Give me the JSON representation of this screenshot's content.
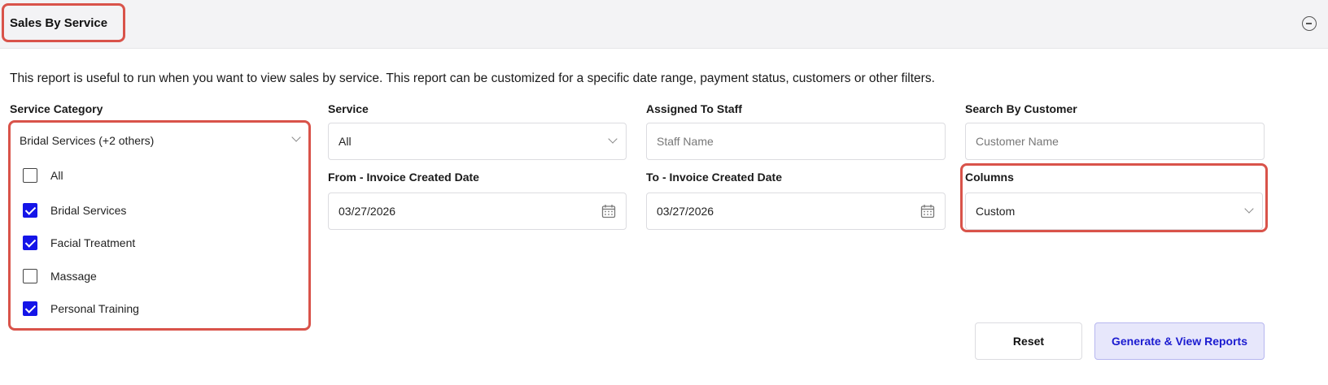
{
  "header": {
    "title": "Sales By Service"
  },
  "description": "This report is useful to run when you want to view sales by service. This report can be customized for a specific date range, payment status, customers or other filters.",
  "filters": {
    "service_category": {
      "label": "Service Category",
      "value": "Bridal Services (+2 others)",
      "options": [
        {
          "label": "All",
          "checked": false
        },
        {
          "label": "Bridal Services",
          "checked": true
        },
        {
          "label": "Facial Treatment",
          "checked": true
        },
        {
          "label": "Massage",
          "checked": false
        },
        {
          "label": "Personal Training",
          "checked": true
        }
      ]
    },
    "service": {
      "label": "Service",
      "value": "All"
    },
    "staff": {
      "label": "Assigned To Staff",
      "placeholder": "Staff Name"
    },
    "customer": {
      "label": "Search By Customer",
      "placeholder": "Customer Name"
    },
    "from_date": {
      "label": "From - Invoice Created Date",
      "value": "03/27/2026"
    },
    "to_date": {
      "label": "To - Invoice Created Date",
      "value": "03/27/2026"
    },
    "columns": {
      "label": "Columns",
      "value": "Custom"
    }
  },
  "actions": {
    "reset_label": "Reset",
    "generate_label": "Generate & View Reports"
  },
  "colors": {
    "highlight": "#d9534a",
    "checkbox_checked": "#1515e8",
    "primary_button_text": "#1b1bd0",
    "primary_button_bg": "#e7e7fb"
  }
}
